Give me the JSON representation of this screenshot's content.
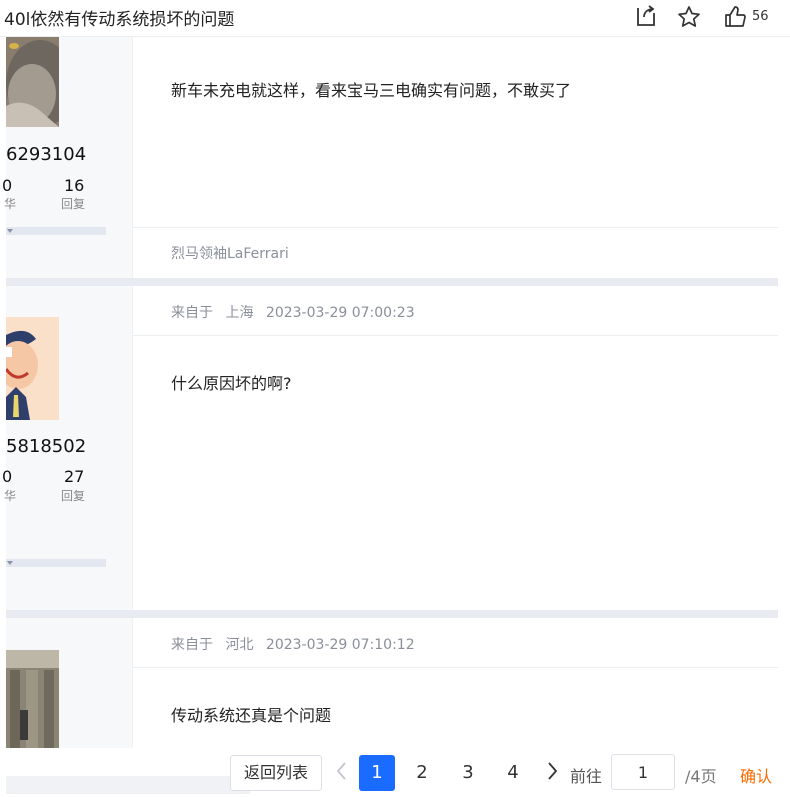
{
  "thread": {
    "title": "40l依然有传动系统损坏的问题"
  },
  "top_actions": {
    "share_icon": "share-icon",
    "favorite_icon": "star-icon",
    "like_icon": "thumbs-up-icon",
    "like_count": "56"
  },
  "posts": [
    {
      "user_id": "6293104",
      "stat_left_num": "0",
      "stat_left_label": "华",
      "replies_num": "16",
      "replies_label": "回复",
      "content": "新车未充电就这样，看来宝马三电确实有问题，不敢买了",
      "signature": "烈马领袖LaFerrari"
    },
    {
      "from_label": "来自于",
      "location": "上海",
      "time": "2023-03-29 07:00:23",
      "user_id": "5818502",
      "stat_left_num": "0",
      "stat_left_label": "华",
      "replies_num": "27",
      "replies_label": "回复",
      "content": "什么原因坏的啊?"
    },
    {
      "from_label": "来自于",
      "location": "河北",
      "time": "2023-03-29 07:10:12",
      "content": "传动系统还真是个问题"
    }
  ],
  "pagination": {
    "back_label": "返回列表",
    "pages": [
      "1",
      "2",
      "3",
      "4"
    ],
    "current": "1",
    "goto_label": "前往",
    "goto_value": "1",
    "total_label": "/4页",
    "confirm_label": "确认"
  },
  "colors": {
    "accent": "#1a6bff",
    "confirm": "#ff6a00"
  }
}
